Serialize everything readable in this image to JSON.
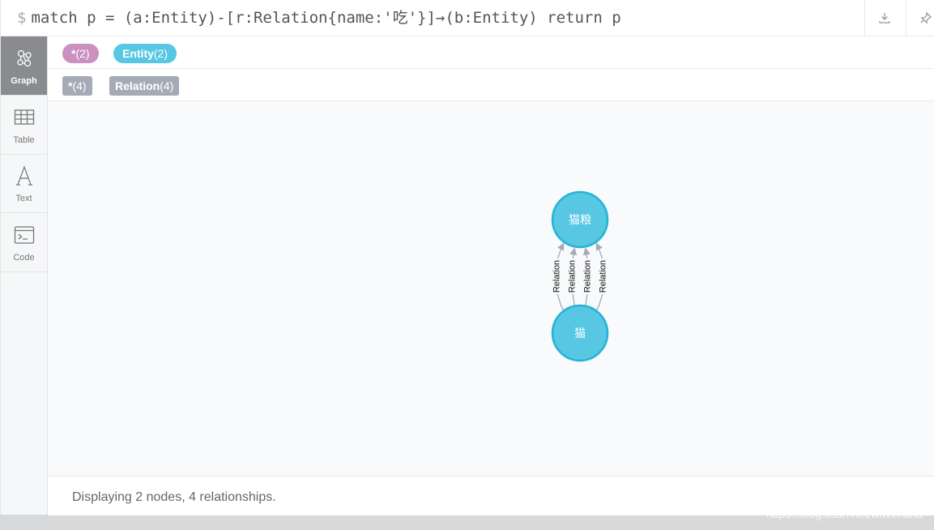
{
  "query": {
    "prompt": "$",
    "text": "match p = (a:Entity)-[r:Relation{name:'吃'}]→(b:Entity) return p"
  },
  "toolbar": {
    "download_icon": "download-icon",
    "pin_icon": "pin-icon"
  },
  "sidebar": {
    "items": [
      {
        "label": "Graph",
        "icon": "graph-icon",
        "active": true
      },
      {
        "label": "Table",
        "icon": "table-icon"
      },
      {
        "label": "Text",
        "icon": "text-icon"
      },
      {
        "label": "Code",
        "icon": "code-icon"
      }
    ]
  },
  "legend": {
    "node_labels": [
      {
        "name": "*",
        "count": "(2)",
        "color": "#c990c0"
      },
      {
        "name": "Entity",
        "count": "(2)",
        "color": "#57c7e3"
      }
    ],
    "relationship_types": [
      {
        "name": "*",
        "count": "(4)",
        "color": "#a5abb6"
      },
      {
        "name": "Relation",
        "count": "(4)",
        "color": "#a5abb6"
      }
    ]
  },
  "graph": {
    "nodes": [
      {
        "id": "food",
        "caption": "猫粮",
        "color": "#57c7e3",
        "border": "#23b3d7"
      },
      {
        "id": "cat",
        "caption": "猫",
        "color": "#57c7e3",
        "border": "#23b3d7"
      }
    ],
    "relationships": [
      {
        "caption": "Relation"
      },
      {
        "caption": "Relation"
      },
      {
        "caption": "Relation"
      },
      {
        "caption": "Relation"
      }
    ]
  },
  "status": {
    "text": "Displaying 2 nodes, 4 relationships."
  },
  "watermark": "https://blog.csdn.net/wavehaha"
}
